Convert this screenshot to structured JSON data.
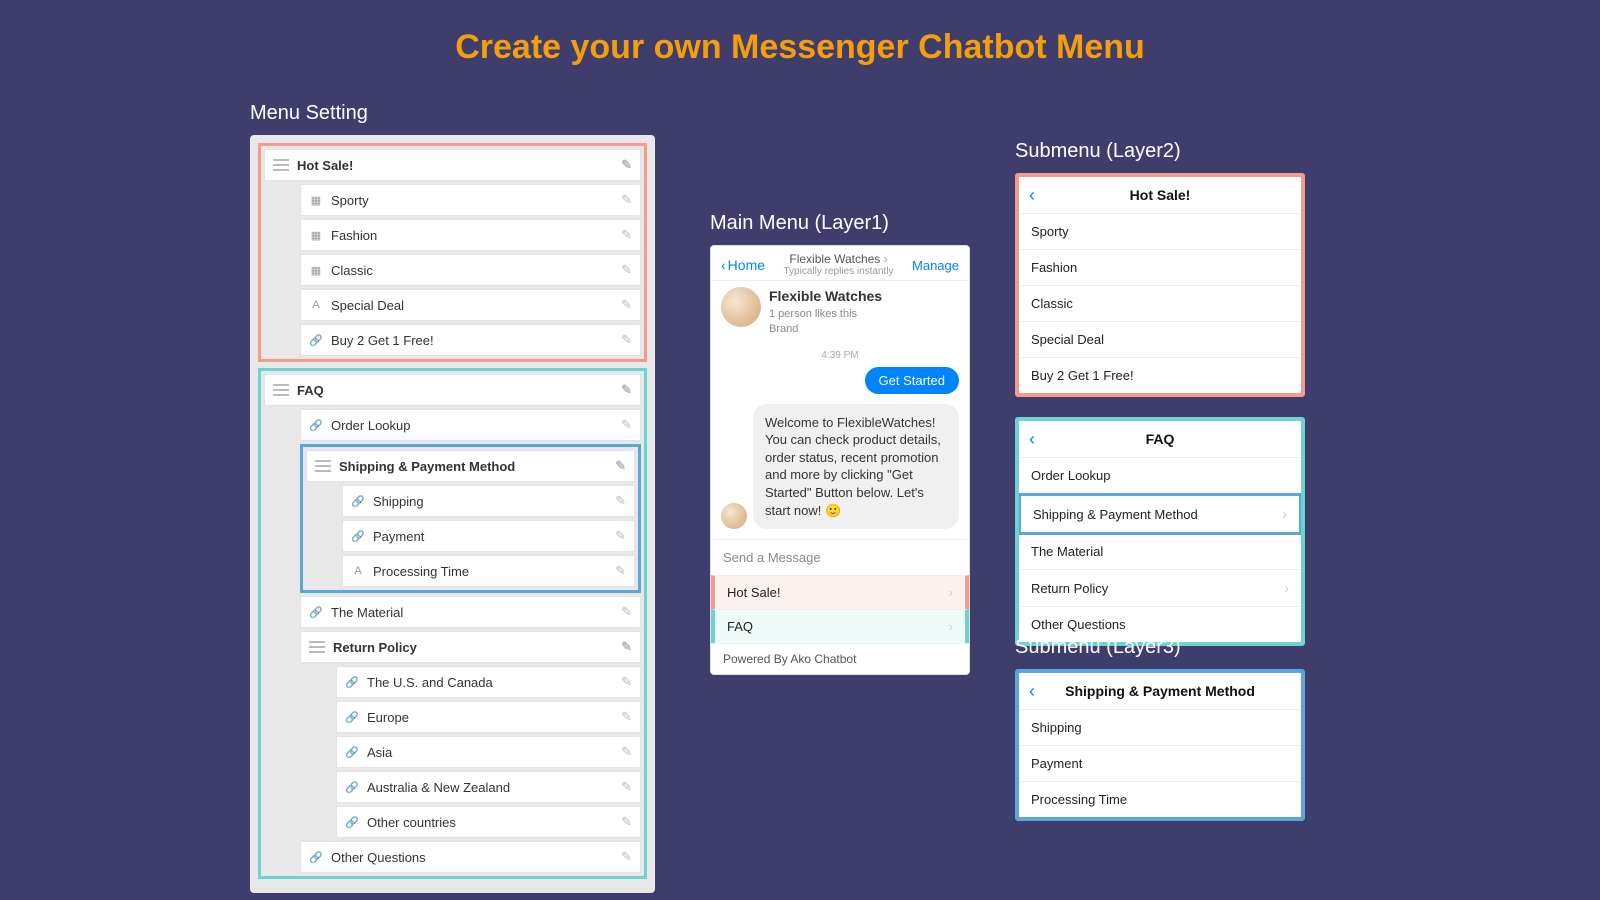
{
  "title": "Create your own Messenger Chatbot Menu",
  "sections": {
    "menu_setting": "Menu Setting",
    "main_menu": "Main Menu (Layer1)",
    "submenu2": "Submenu (Layer2)",
    "submenu3": "Submenu (Layer3)"
  },
  "menu_setting": {
    "groups": [
      {
        "color": "salmon",
        "header": "Hot Sale!",
        "items": [
          {
            "label": "Sporty",
            "icon": "card"
          },
          {
            "label": "Fashion",
            "icon": "card"
          },
          {
            "label": "Classic",
            "icon": "card"
          },
          {
            "label": "Special Deal",
            "icon": "text"
          },
          {
            "label": "Buy 2 Get 1 Free!",
            "icon": "link"
          }
        ]
      },
      {
        "color": "teal",
        "header": "FAQ",
        "items": [
          {
            "label": "Order Lookup",
            "icon": "link"
          },
          {
            "group": {
              "color": "blue",
              "header": "Shipping & Payment Method",
              "items": [
                {
                  "label": "Shipping",
                  "icon": "link"
                },
                {
                  "label": "Payment",
                  "icon": "link"
                },
                {
                  "label": "Processing Time",
                  "icon": "text"
                }
              ]
            }
          },
          {
            "label": "The Material",
            "icon": "link"
          },
          {
            "header": "Return Policy",
            "items": [
              {
                "label": "The U.S. and Canada",
                "icon": "link"
              },
              {
                "label": "Europe",
                "icon": "link"
              },
              {
                "label": "Asia",
                "icon": "link"
              },
              {
                "label": "Australia & New Zealand",
                "icon": "link"
              },
              {
                "label": "Other countries",
                "icon": "link"
              }
            ]
          },
          {
            "label": "Other Questions",
            "icon": "link"
          }
        ]
      }
    ]
  },
  "messenger": {
    "home": "Home",
    "title": "Flexible Watches",
    "subtitle": "Typically replies instantly",
    "manage": "Manage",
    "profile_name": "Flexible Watches",
    "likes": "1 person likes this",
    "brand": "Brand",
    "time": "4:39 PM",
    "get_started": "Get Started",
    "welcome": "Welcome to FlexibleWatches! You can check product details, order status, recent promotion and more by clicking \"Get Started\" Button below. Let's start now! 🙂",
    "input_placeholder": "Send a Message",
    "menu": [
      {
        "label": "Hot Sale!",
        "color": "salmon"
      },
      {
        "label": "FAQ",
        "color": "teal"
      }
    ],
    "footer": "Powered By Ako Chatbot"
  },
  "submenu2a": {
    "title": "Hot Sale!",
    "items": [
      "Sporty",
      "Fashion",
      "Classic",
      "Special Deal",
      "Buy 2 Get 1 Free!"
    ]
  },
  "submenu2b": {
    "title": "FAQ",
    "items": [
      {
        "label": "Order Lookup"
      },
      {
        "label": "Shipping & Payment Method",
        "chev": true,
        "hl": true
      },
      {
        "label": "The Material"
      },
      {
        "label": "Return Policy",
        "chev": true
      },
      {
        "label": "Other Questions"
      }
    ]
  },
  "submenu3": {
    "title": "Shipping & Payment Method",
    "items": [
      "Shipping",
      "Payment",
      "Processing Time"
    ]
  }
}
